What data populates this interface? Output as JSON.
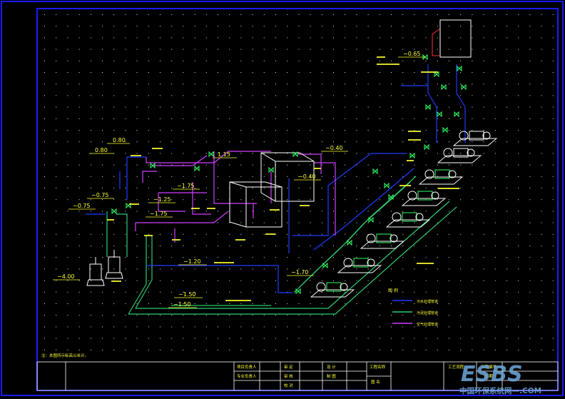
{
  "elevations": {
    "e080_top": "0.80",
    "e080_left": "0.80",
    "e075_a": "−0.75",
    "e075_b": "−0.75",
    "e400": "−4.00",
    "e115": "1.15",
    "e175_a": "−1.75",
    "e125": "−1.25",
    "e175_b": "−1.75",
    "e040_a": "−0.40",
    "e040_b": "−0.40",
    "e065": "−0.65",
    "e120": "−1.20",
    "e170": "−1.70",
    "e150_a": "−1.50",
    "e150_b": "−1.50"
  },
  "notes": {
    "bottom_left": "注：本图所示标高以米计。"
  },
  "legend": {
    "title": "图  例",
    "items": [
      {
        "label": "污水处理管道",
        "color": "#1e3cff"
      },
      {
        "label": "污泥处理管道",
        "color": "#2ecc71"
      },
      {
        "label": "空气处理管道",
        "color": "#d040ff"
      }
    ]
  },
  "title_block": {
    "r1c1": "项目负责人",
    "r1c2": "审  定",
    "r1c3": "设  计",
    "r1c4": "工程名称",
    "r1c5": "工程编号",
    "r2c1": "专业负责人",
    "r2c2": "审  核",
    "r2c3": "制  图",
    "r2c5": "日  期",
    "r3c2": "校  对",
    "r3c4": "图  名",
    "drawing_name": "工艺流程"
  },
  "watermark": {
    "logo": "ESBS",
    "site": "中国环保系统网—.COM"
  },
  "colors": {
    "frame": "#1a1aff",
    "sewage": "#1e3cff",
    "sludge": "#2ecc71",
    "air": "#d040ff",
    "equip": "#ffffff",
    "pump": "#33ff66",
    "annot": "#ffff33",
    "grid_dot": "#e8e8e8"
  }
}
